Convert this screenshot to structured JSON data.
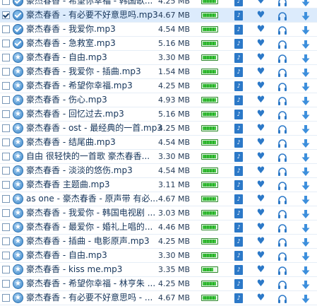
{
  "rows": [
    {
      "checked": false,
      "status": "check",
      "name": "豪杰春香 - 希望你幸福 - 韩国歌...",
      "size": "4.25 MB",
      "level": 0.85,
      "selected": false
    },
    {
      "checked": true,
      "status": "check",
      "name": "豪杰春香 - 有必要不好意思吗.mp3",
      "size": "4.67 MB",
      "level": 0.85,
      "selected": true
    },
    {
      "checked": false,
      "status": "check",
      "name": "豪杰春香 - 我爱你.mp3",
      "size": "4.54 MB",
      "level": 0.85,
      "selected": false
    },
    {
      "checked": false,
      "status": "check",
      "name": "豪杰春香 - 急救室.mp3",
      "size": "5.16 MB",
      "level": 0.85,
      "selected": false
    },
    {
      "checked": false,
      "status": "star",
      "name": "豪杰春香 - 自由.mp3",
      "size": "3.30 MB",
      "level": 0.85,
      "selected": false
    },
    {
      "checked": false,
      "status": "star",
      "name": "豪杰春香 - 我爱你 - 插曲.mp3",
      "size": "1.54 MB",
      "level": 0.85,
      "selected": false
    },
    {
      "checked": false,
      "status": "star",
      "name": "豪杰春香 - 希望你幸福.mp3",
      "size": "4.25 MB",
      "level": 0.85,
      "selected": false
    },
    {
      "checked": false,
      "status": "star",
      "name": "豪杰春香 - 伤心.mp3",
      "size": "4.93 MB",
      "level": 0.85,
      "selected": false
    },
    {
      "checked": false,
      "status": "star",
      "name": "豪杰春香 - 回忆过去.mp3",
      "size": "5.16 MB",
      "level": 0.85,
      "selected": false
    },
    {
      "checked": false,
      "status": "star",
      "name": "豪杰春香 - ost - 最经典的一首.mp3",
      "size": "4.25 MB",
      "level": 0.85,
      "selected": false
    },
    {
      "checked": false,
      "status": "star",
      "name": "豪杰春香 - 结尾曲.mp3",
      "size": "4.54 MB",
      "level": 0.85,
      "selected": false
    },
    {
      "checked": false,
      "status": "star",
      "name": "自由 很轻快的一首歌 豪杰春香...",
      "size": "3.30 MB",
      "level": 0.85,
      "selected": false
    },
    {
      "checked": false,
      "status": "star",
      "name": "豪杰春香 - 淡淡的悠伤.mp3",
      "size": "4.54 MB",
      "level": 0.85,
      "selected": false
    },
    {
      "checked": false,
      "status": "star",
      "name": "豪杰春香 主题曲.mp3",
      "size": "3.11 MB",
      "level": 0.85,
      "selected": false
    },
    {
      "checked": false,
      "status": "star",
      "name": "as one - 豪杰春香 - 原声带 有必...",
      "size": "4.67 MB",
      "level": 0.85,
      "selected": false
    },
    {
      "checked": false,
      "status": "star",
      "name": "豪杰春香 - 我爱你 - 韩国电视剧 ...",
      "size": "3.03 MB",
      "level": 0.85,
      "selected": false
    },
    {
      "checked": false,
      "status": "star",
      "name": "豪杰春香 - 最爱你 - 婚礼上唱的...",
      "size": "4.46 MB",
      "level": 0.85,
      "selected": false
    },
    {
      "checked": false,
      "status": "star",
      "name": "豪杰春香 - 插曲 - 电影原声.mp3",
      "size": "4.25 MB",
      "level": 0.85,
      "selected": false
    },
    {
      "checked": false,
      "status": "star",
      "name": "豪杰春香 - 自由.mp3",
      "size": "3.30 MB",
      "level": 0.85,
      "selected": false
    },
    {
      "checked": false,
      "status": "star",
      "name": "豪杰春香 - kiss me.mp3",
      "size": "3.35 MB",
      "level": 0.7,
      "selected": false
    },
    {
      "checked": false,
      "status": "star",
      "name": "豪杰春香 - 希望你幸福 - 林亨朱 ...",
      "size": "4.25 MB",
      "level": 0.85,
      "selected": false
    },
    {
      "checked": false,
      "status": "star",
      "name": "豪杰春香 - 有必要不好意思吗 - ...",
      "size": "4.67 MB",
      "level": 0.85,
      "selected": false
    }
  ],
  "icons": {
    "lyrics": "lyrics-icon",
    "favorite": "favorite-icon",
    "headphone": "headphone-icon",
    "download": "download-icon"
  },
  "colors": {
    "selected_row": "#dcebfc",
    "meter_green": "#3fc43f",
    "icon_blue": "#2c79c8"
  }
}
